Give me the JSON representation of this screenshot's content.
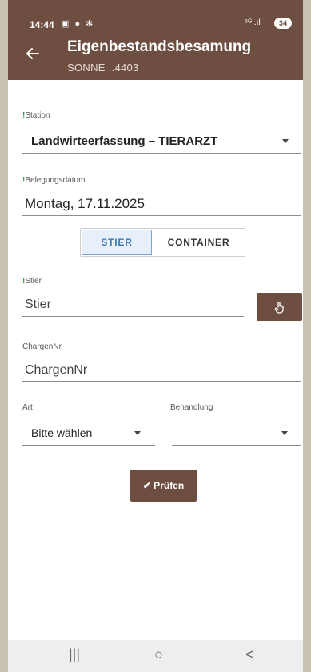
{
  "status_bar": {
    "time": "14:44",
    "battery": "34",
    "notification_icons": "▣ ● ✻",
    "signal": "⁵ᴳ .ıl"
  },
  "app_bar": {
    "title": "Eigenbestandsbesamung",
    "subtitle": "SONNE ..4403",
    "back_icon": "arrow-left-icon"
  },
  "form": {
    "station": {
      "required_mark": "!",
      "label": "Station",
      "value": "Landwirteerfassung – TIERARZT"
    },
    "belegungsdatum": {
      "required_mark": "!",
      "label": "Belegungsdatum",
      "value": "Montag, 17.11.2025"
    },
    "toggle": {
      "stier": "STIER",
      "container": "CONTAINER",
      "selected": "STIER"
    },
    "stier": {
      "required_mark": "!",
      "label": "Stier",
      "placeholder": "Stier",
      "button_icon": "hand-pointer-icon"
    },
    "chargennr": {
      "label": "ChargenNr",
      "placeholder": "ChargenNr"
    },
    "art": {
      "label": "Art",
      "value": "Bitte wählen"
    },
    "behandlung": {
      "label": "Behandlung",
      "value": ""
    },
    "submit_label": "✔ Prüfen"
  },
  "nav_bar": {
    "recents": "|||",
    "home": "○",
    "back": "<"
  },
  "colors": {
    "primary": "#6f4e42",
    "required": "#35a24a",
    "toggle_selected": "#3a77b7"
  }
}
